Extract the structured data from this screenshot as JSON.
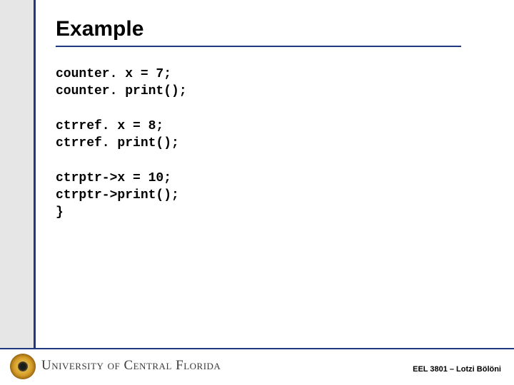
{
  "title": "Example",
  "code": {
    "block1_line1": "counter. x = 7;",
    "block1_line2": "counter. print();",
    "block2_line1": "ctrref. x = 8;",
    "block2_line2": "ctrref. print();",
    "block3_line1": "ctrptr->x = 10;",
    "block3_line2": "ctrptr->print();",
    "block3_line3": "}"
  },
  "footer": {
    "university": "University of Central Florida",
    "course": "EEL 3801 – Lotzi Bölöni"
  }
}
